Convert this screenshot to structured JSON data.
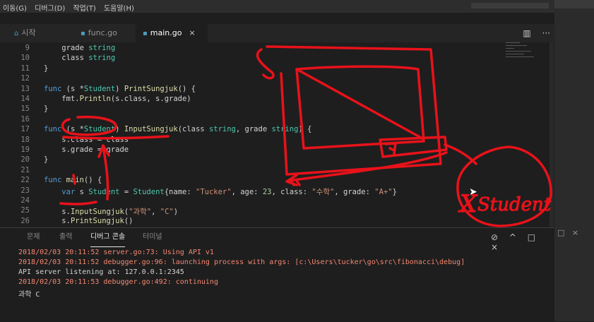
{
  "menu": [
    "이동(G)",
    "디버그(D)",
    "작업(T)",
    "도움말(H)"
  ],
  "tabs": [
    {
      "label": "시작",
      "icon": "vscode-icon",
      "active": false
    },
    {
      "label": "func.go",
      "icon": "go-file-icon",
      "active": false
    },
    {
      "label": "main.go",
      "icon": "go-file-icon",
      "active": true
    }
  ],
  "tab_actions": {
    "split": "▥",
    "more": "···"
  },
  "code_lines": [
    {
      "n": "9",
      "html": "    grade <span class='ty'>string</span>"
    },
    {
      "n": "10",
      "html": "    class <span class='ty'>string</span>"
    },
    {
      "n": "11",
      "html": "}"
    },
    {
      "n": "12",
      "html": ""
    },
    {
      "n": "13",
      "html": "<span class='kw'>func</span> (s *<span class='ty'>Student</span>) <span class='fn'>PrintSungjuk</span>() {"
    },
    {
      "n": "14",
      "html": "    fmt.<span class='fn'>Println</span>(s.class, s.grade)"
    },
    {
      "n": "15",
      "html": "}"
    },
    {
      "n": "16",
      "html": ""
    },
    {
      "n": "17",
      "html": "<span class='kw'>func</span> (s *<span class='ty'>Student</span>) <span class='fn'>InputSungjuk</span>(class <span class='ty'>string</span>, grade <span class='ty'>string</span>) {"
    },
    {
      "n": "18",
      "html": "    s.class = class"
    },
    {
      "n": "19",
      "html": "    s.grade = grade"
    },
    {
      "n": "20",
      "html": "}"
    },
    {
      "n": "21",
      "html": ""
    },
    {
      "n": "22",
      "html": "<span class='kw'>func</span> <span class='fn'>main</span>() {"
    },
    {
      "n": "23",
      "html": "    <span class='kw'>var</span> s <span class='ty'>Student</span> = <span class='ty'>Student</span>{name: <span class='str'>\"Tucker\"</span>, age: <span class='num'>23</span>, class: <span class='str'>\"수학\"</span>, grade: <span class='str'>\"A+\"</span>}"
    },
    {
      "n": "24",
      "html": ""
    },
    {
      "n": "25",
      "html": "    s.<span class='fn'>InputSungjuk</span>(<span class='str'>\"과학\"</span>, <span class='str'>\"C\"</span>)"
    },
    {
      "n": "26",
      "html": "    s.<span class='fn'>PrintSungjuk</span>()"
    }
  ],
  "panel_tabs": [
    "문제",
    "출력",
    "디버그 콘솔",
    "터미널"
  ],
  "panel_active": "디버그 콘솔",
  "panel_actions": {
    "clear": "⊘",
    "maximize": "^",
    "split": "□",
    "close": "×"
  },
  "console": [
    {
      "text": "2018/02/03 20:11:52 server.go:73: Using API v1",
      "kind": "err"
    },
    {
      "text": "2018/02/03 20:11:52 debugger.go:96: launching process with args: [c:\\Users\\tucker\\go\\src\\fibonacci\\debug]",
      "kind": "err"
    },
    {
      "text": "API server listening at: 127.0.0.1:2345",
      "kind": "norm"
    },
    {
      "text": "2018/02/03 20:11:53 debugger.go:492: continuing",
      "kind": "err"
    },
    {
      "text": "과학 C",
      "kind": "norm"
    }
  ],
  "annotation_label": "Student",
  "colors": {
    "ink": "#e8121a",
    "keyword": "#569cd6",
    "function": "#dcdcaa",
    "string": "#ce9178",
    "type": "#4ec9b0"
  }
}
